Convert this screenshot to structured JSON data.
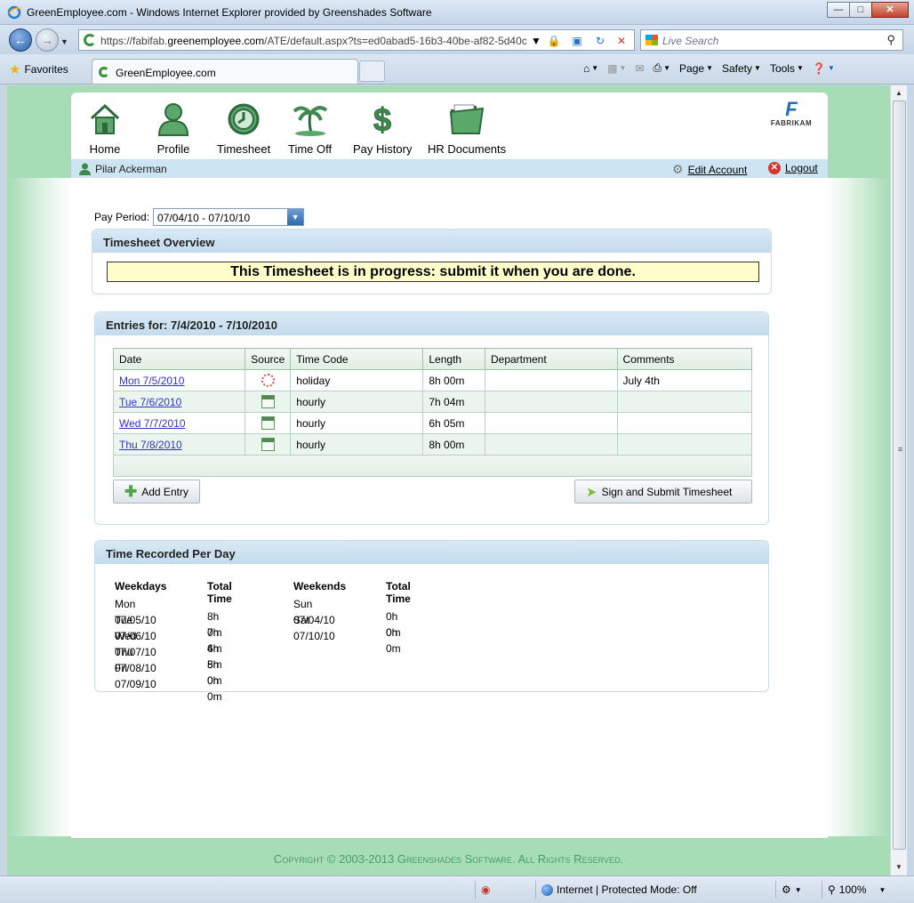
{
  "window": {
    "title": "GreenEmployee.com - Windows Internet Explorer provided by Greenshades Software",
    "address_host": "https://fabifab.",
    "address_domain": "greenemployee.com",
    "address_path": "/ATE/default.aspx?ts=ed0abad5-16b3-40be-af82-5d40c",
    "search_placeholder": "Live Search",
    "tab_label": "GreenEmployee.com",
    "favorites_label": "Favorites",
    "cmd": {
      "page": "Page",
      "safety": "Safety",
      "tools": "Tools"
    }
  },
  "nav": [
    {
      "label": "Home",
      "icon": "home-icon"
    },
    {
      "label": "Profile",
      "icon": "profile-icon"
    },
    {
      "label": "Timesheet",
      "icon": "clock-icon"
    },
    {
      "label": "Time Off",
      "icon": "palm-tree-icon"
    },
    {
      "label": "Pay History",
      "icon": "dollar-icon"
    },
    {
      "label": "HR Documents",
      "icon": "folder-icon"
    }
  ],
  "brand": {
    "name": "FABRIKAM"
  },
  "user": {
    "name": "Pilar Ackerman",
    "edit_account": "Edit Account",
    "logout": "Logout"
  },
  "pay_period": {
    "label": "Pay Period:",
    "selected": "07/04/10 - 07/10/10"
  },
  "overview": {
    "title": "Timesheet Overview",
    "notice": "This Timesheet is in progress: submit it when you are done."
  },
  "entries": {
    "title": "Entries for: 7/4/2010 - 7/10/2010",
    "columns": [
      "Date",
      "Source",
      "Time Code",
      "Length",
      "Department",
      "Comments"
    ],
    "rows": [
      {
        "date": "Mon 7/5/2010",
        "source": "holiday-icon",
        "code": "holiday",
        "length": "8h 00m",
        "dept": "",
        "comments": "July 4th"
      },
      {
        "date": "Tue 7/6/2010",
        "source": "calendar-icon",
        "code": "hourly",
        "length": "7h 04m",
        "dept": "",
        "comments": ""
      },
      {
        "date": "Wed 7/7/2010",
        "source": "calendar-icon",
        "code": "hourly",
        "length": "6h 05m",
        "dept": "",
        "comments": ""
      },
      {
        "date": "Thu 7/8/2010",
        "source": "calendar-icon",
        "code": "hourly",
        "length": "8h 00m",
        "dept": "",
        "comments": ""
      }
    ],
    "add_entry": "Add Entry",
    "submit": "Sign and Submit Timesheet"
  },
  "per_day": {
    "title": "Time Recorded Per Day",
    "weekdays_header": "Weekdays",
    "weekends_header": "Weekends",
    "total_header": "Total Time",
    "weekdays": [
      {
        "day": "Mon 07/05/10",
        "total": "8h 0m"
      },
      {
        "day": "Tue 07/06/10",
        "total": "7h 4m"
      },
      {
        "day": "Wed 07/07/10",
        "total": "6h 5m"
      },
      {
        "day": "Thu 07/08/10",
        "total": "8h 0m"
      },
      {
        "day": "Fri 07/09/10",
        "total": "0h 0m"
      }
    ],
    "weekends": [
      {
        "day": "Sun 07/04/10",
        "total": "0h 0m"
      },
      {
        "day": "Sat 07/10/10",
        "total": "0h 0m"
      }
    ]
  },
  "footer": {
    "copyright": "Copyright © 2003-2013 Greenshades Software. All Rights Reserved."
  },
  "status": {
    "zone": "Internet | Protected Mode: Off",
    "zoom": "100%"
  }
}
